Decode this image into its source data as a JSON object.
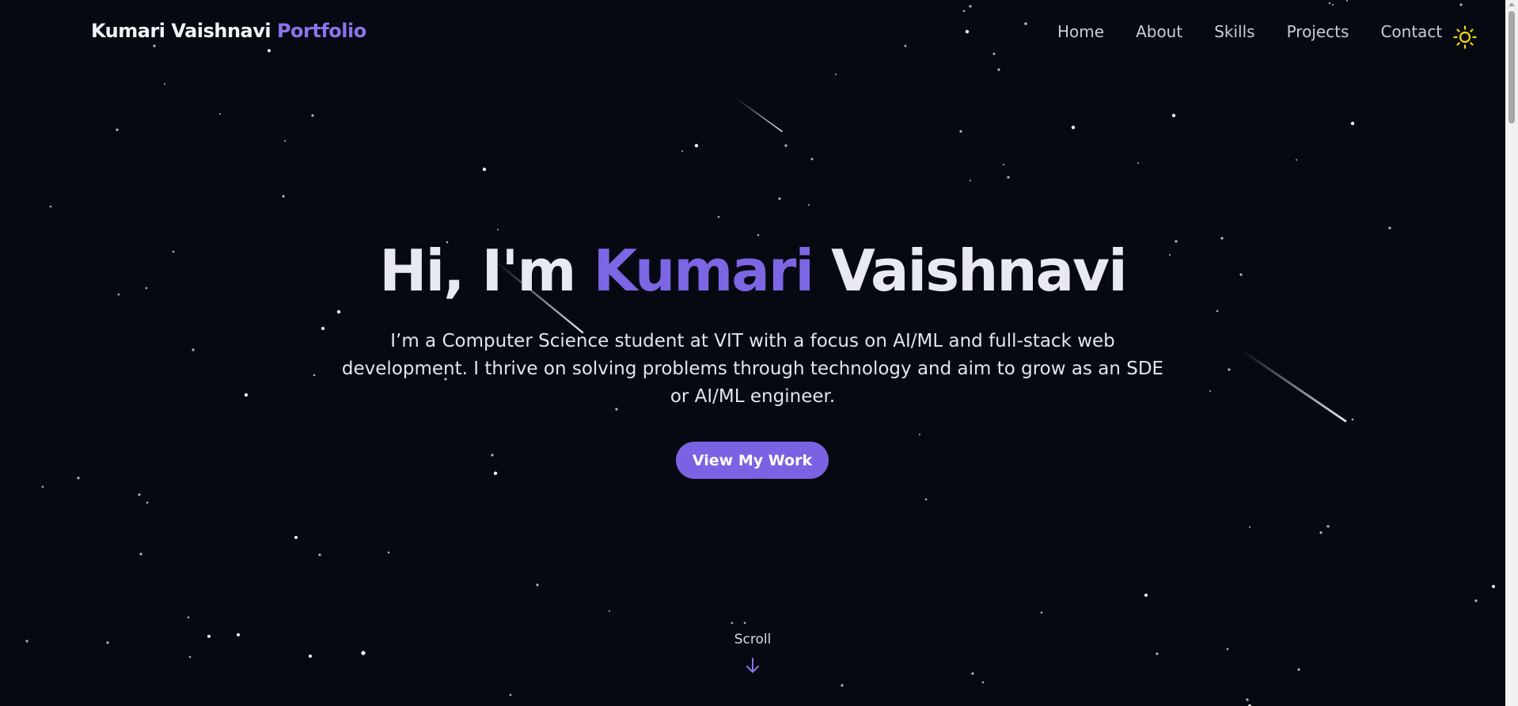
{
  "brand": {
    "name": "Kumari Vaishnavi",
    "accent": "Portfolio"
  },
  "nav": {
    "items": [
      "Home",
      "About",
      "Skills",
      "Projects",
      "Contact"
    ]
  },
  "theme_toggle": {
    "icon": "sun-icon",
    "color": "#f5d90a"
  },
  "hero": {
    "greeting": "Hi, I'm",
    "first_name": "Kumari",
    "last_name": "Vaishnavi",
    "description": "I’m a Computer Science student at VIT with a focus on AI/ML and full-stack web development. I thrive on solving problems through technology and aim to grow as an SDE or AI/ML engineer.",
    "cta_label": "View My Work"
  },
  "scroll": {
    "label": "Scroll",
    "icon": "arrow-down-icon"
  },
  "colors": {
    "background": "#070912",
    "accent": "#7b62e3",
    "text": "#e6e8f2"
  }
}
